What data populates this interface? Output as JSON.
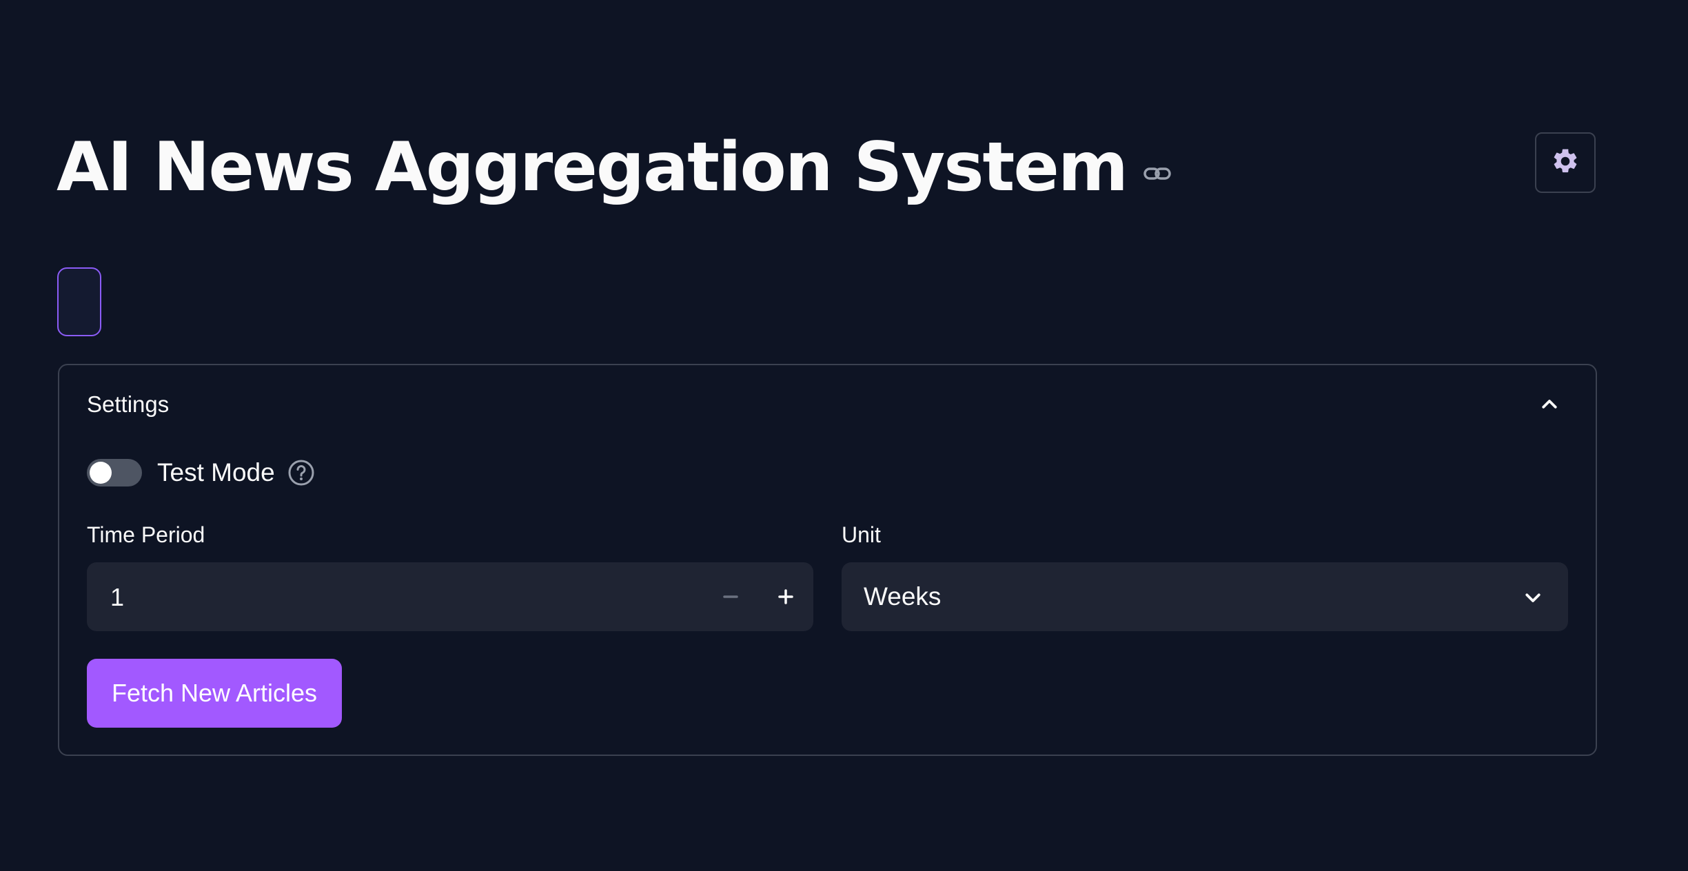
{
  "page": {
    "title": "AI News Aggregation System"
  },
  "settings": {
    "expander_label": "Settings",
    "test_mode": {
      "label": "Test Mode",
      "checked": false
    },
    "time_period": {
      "label": "Time Period",
      "value": "1"
    },
    "unit": {
      "label": "Unit",
      "selected": "Weeks"
    },
    "fetch_button_label": "Fetch New Articles"
  },
  "colors": {
    "background": "#0e1424",
    "accent": "#a259ff",
    "focus_border": "#8b5cf6",
    "input_bg": "#1f2433",
    "border": "#3b4150"
  },
  "icons": {
    "anchor": "link-icon",
    "gear": "gear-icon",
    "help": "help-icon",
    "collapse": "chevron-up-icon",
    "dropdown": "chevron-down-icon",
    "minus": "minus-icon",
    "plus": "plus-icon"
  }
}
